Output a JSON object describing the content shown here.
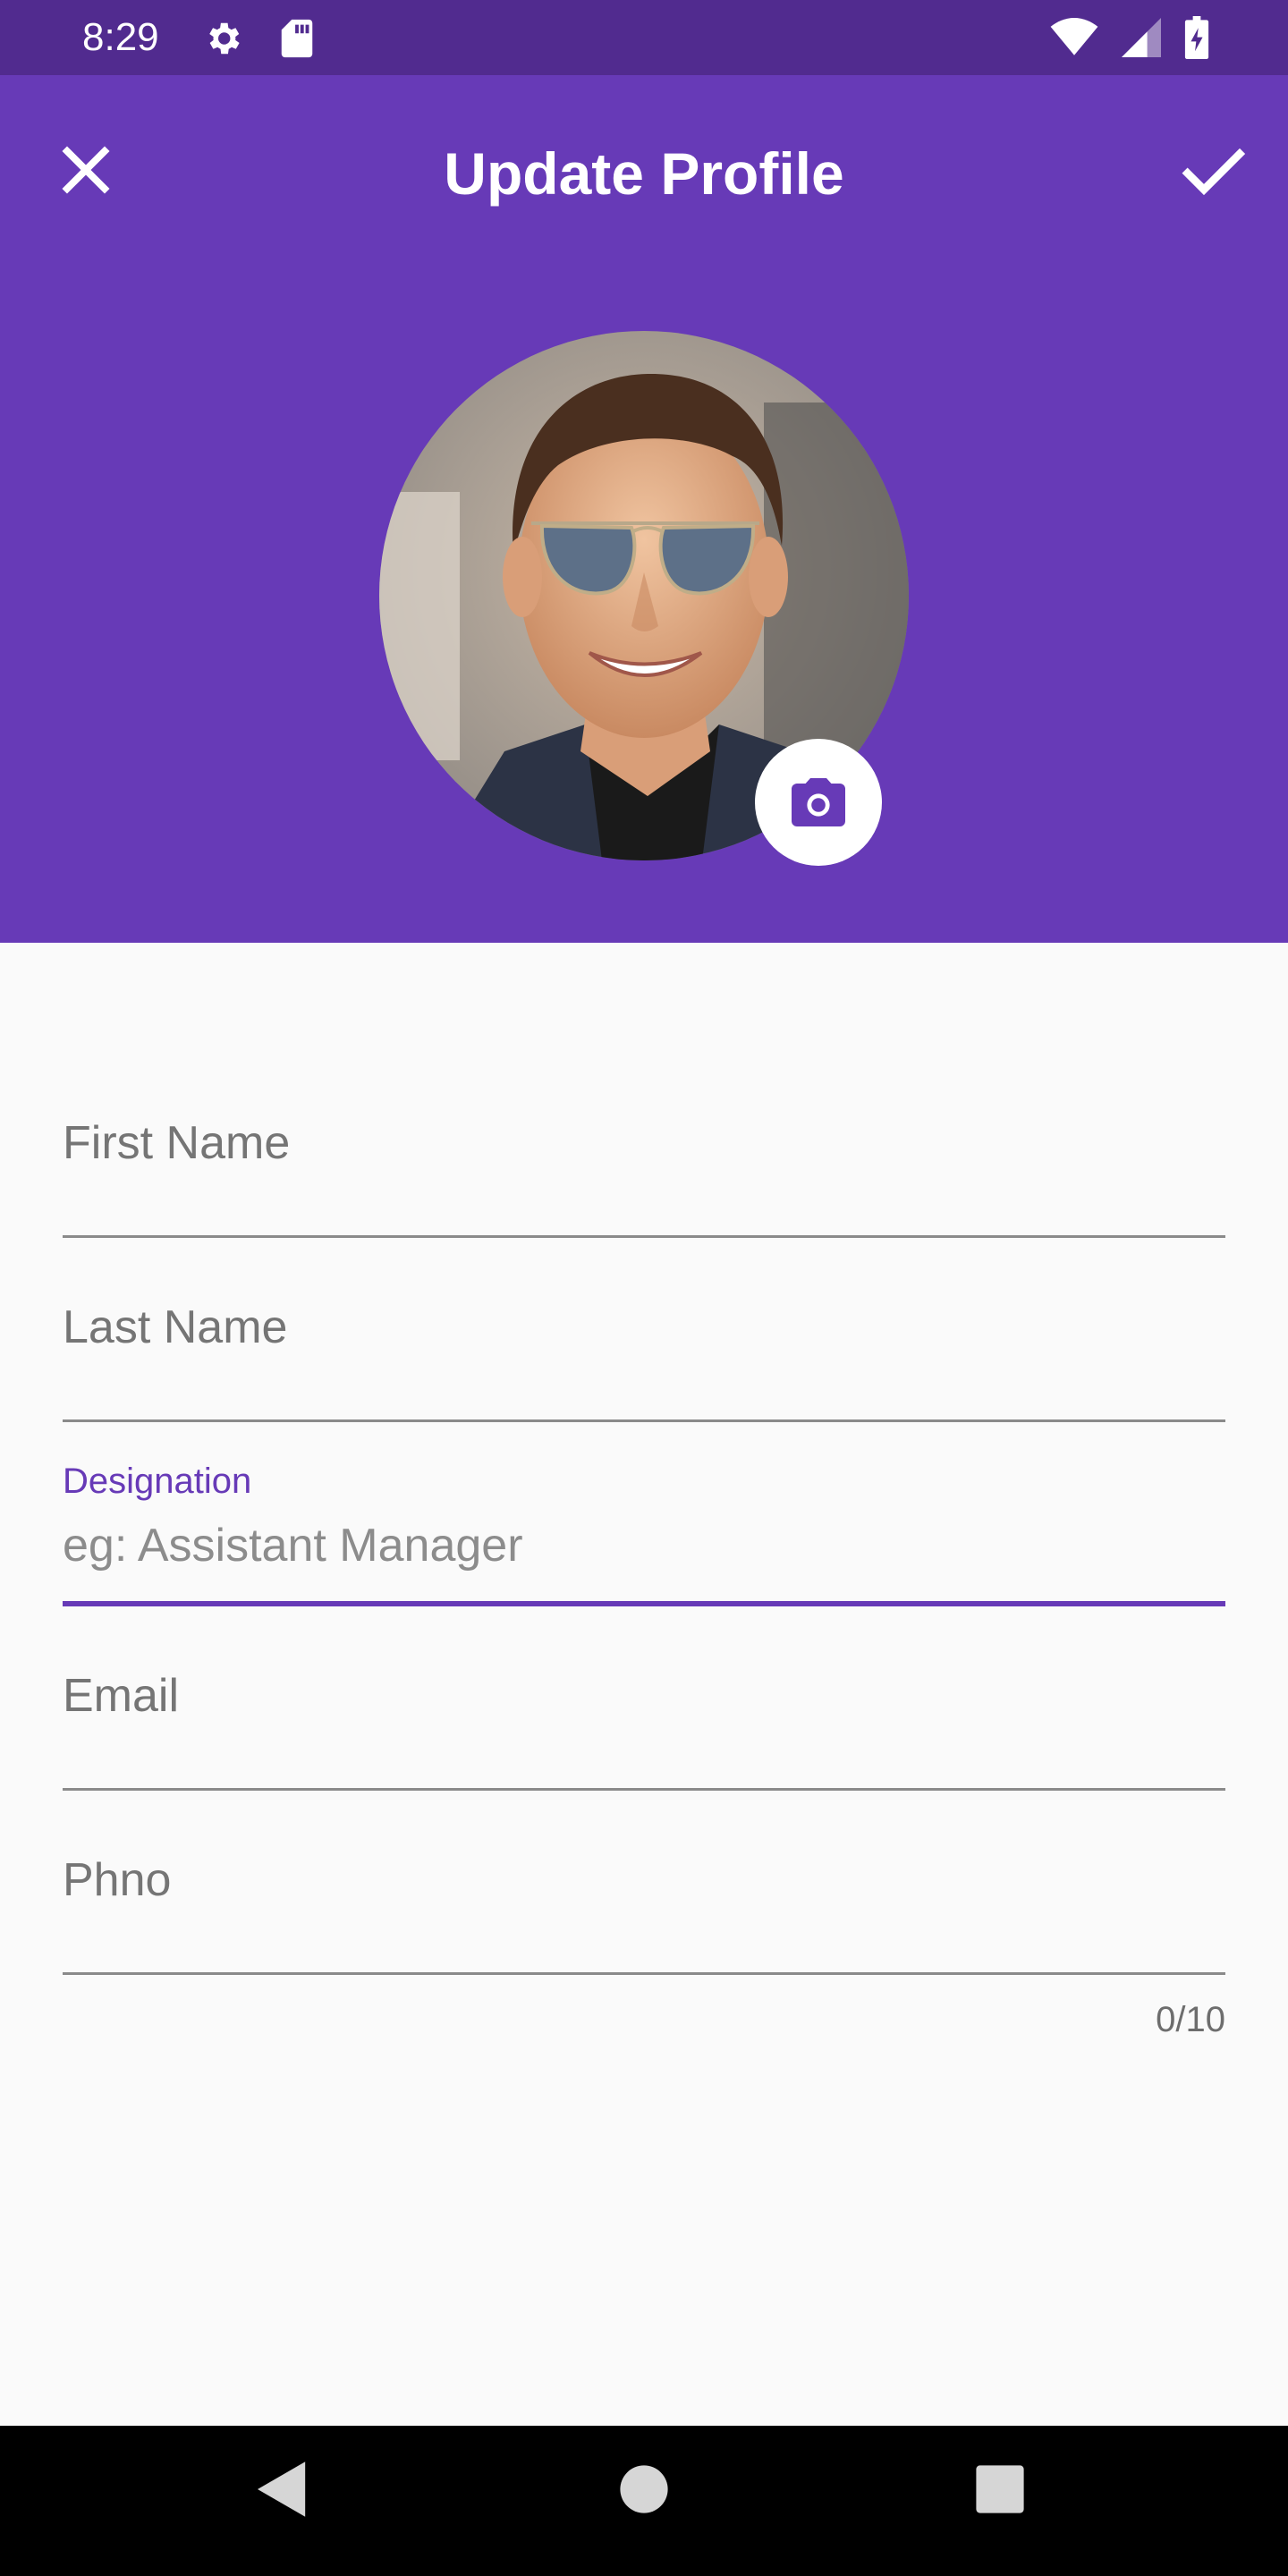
{
  "status_bar": {
    "time": "8:29",
    "icons": [
      "settings-icon",
      "sd-card-icon",
      "wifi-icon",
      "signal-icon",
      "battery-charging-icon"
    ]
  },
  "app_bar": {
    "title": "Update Profile",
    "close_icon": "close-icon",
    "confirm_icon": "check-icon",
    "background_color": "#673ab7"
  },
  "profile": {
    "avatar_description": "profile photo",
    "camera_icon": "camera-icon"
  },
  "form": {
    "first_name": {
      "label": "First Name",
      "value": ""
    },
    "last_name": {
      "label": "Last Name",
      "value": ""
    },
    "designation": {
      "label": "Designation",
      "placeholder": "eg: Assistant Manager",
      "value": ""
    },
    "email": {
      "label": "Email",
      "value": ""
    },
    "phone": {
      "label": "Phno",
      "value": "",
      "counter": "0/10"
    }
  },
  "nav_bar": {
    "icons": [
      "back-icon",
      "home-icon",
      "recents-icon"
    ]
  }
}
